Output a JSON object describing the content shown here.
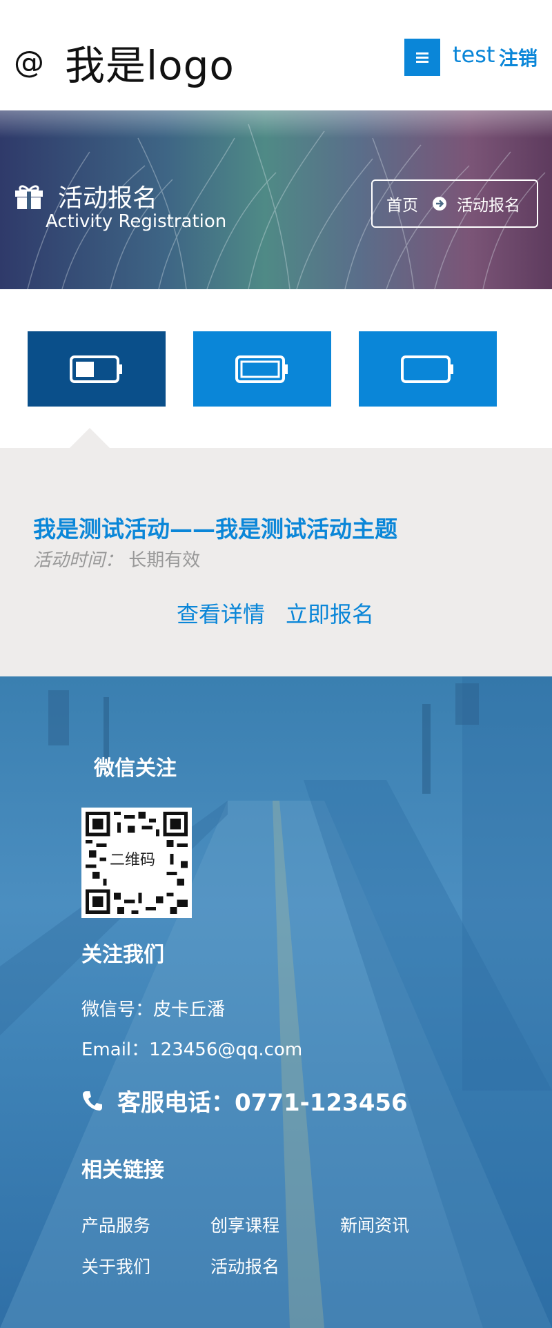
{
  "header": {
    "logo_at": "@",
    "logo_text": "我是logo",
    "user": "test",
    "logout": "注销"
  },
  "banner": {
    "title_cn": "活动报名",
    "title_en": "Activity Registration",
    "breadcrumb": {
      "home": "首页",
      "current": "活动报名"
    }
  },
  "activity": {
    "title": "我是测试活动——我是测试活动主题",
    "time_label": "活动时间：",
    "time_value": "长期有效",
    "detail": "查看详情",
    "signup": "立即报名"
  },
  "footer": {
    "wechat_title": "微信关注",
    "qr_label": "二维码",
    "follow_title": "关注我们",
    "wechat_id": "微信号：皮卡丘潘",
    "email": "Email：123456@qq.com",
    "phone": "客服电话：0771-123456",
    "links_title": "相关链接",
    "links": [
      "产品服务",
      "创享课程",
      "新闻资讯",
      "关于我们",
      "活动报名"
    ]
  },
  "colors": {
    "accent": "#0a86d8",
    "accent_dark": "#0a4f8a",
    "panel_bg": "#eeeceb"
  },
  "icons": [
    "menu-icon",
    "gift-icon",
    "arrow-circle-right-icon",
    "battery-half-icon",
    "battery-full-icon",
    "battery-empty-icon",
    "phone-icon",
    "qr-code-icon"
  ]
}
